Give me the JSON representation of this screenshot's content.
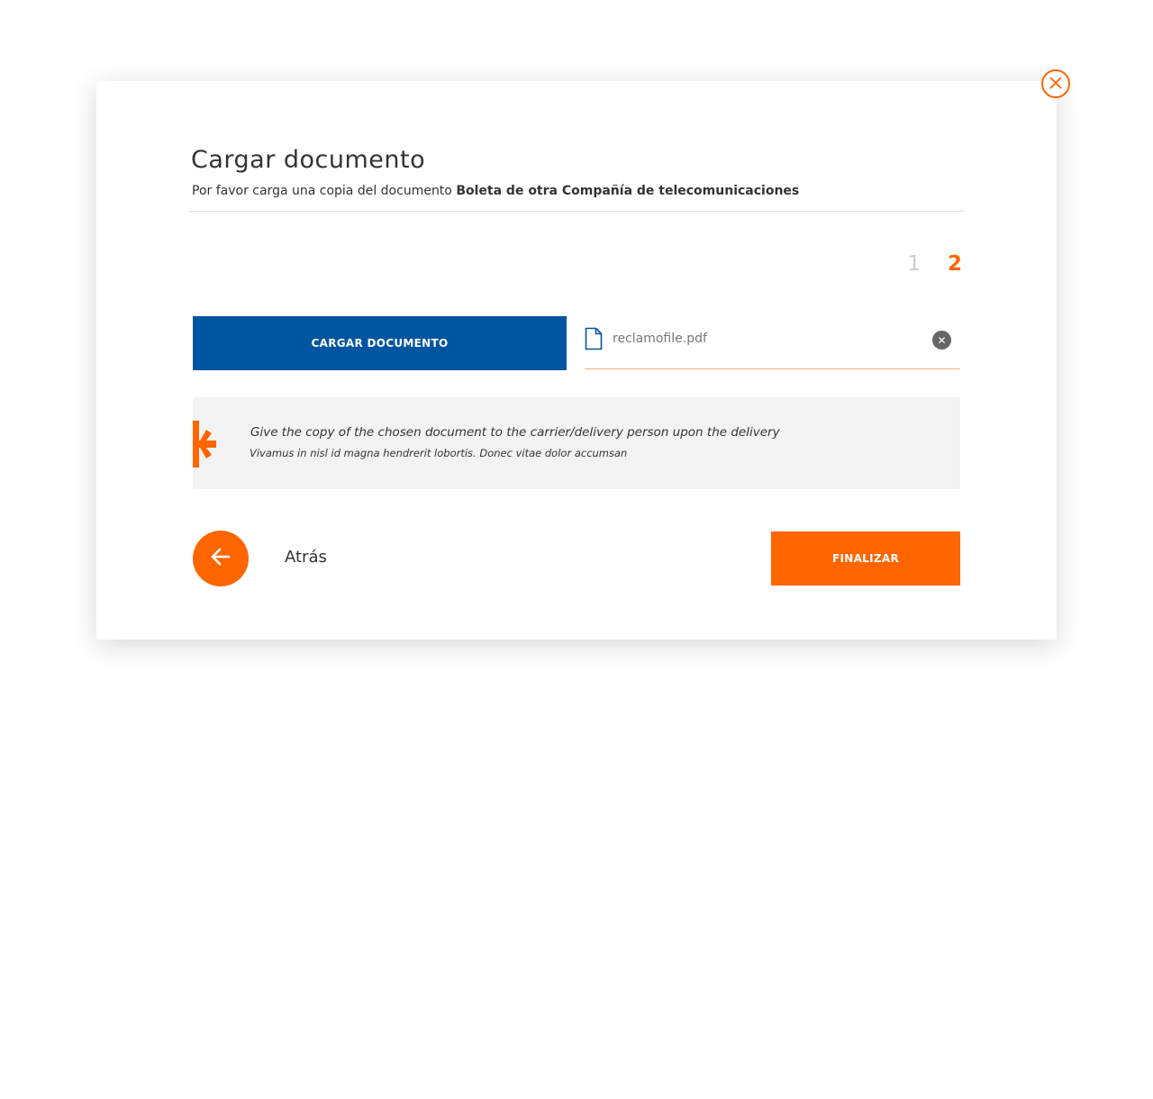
{
  "modal": {
    "title": "Cargar documento",
    "subtitle_prefix": "Por favor carga una copia del documento ",
    "subtitle_document": "Boleta de otra Compañía de telecomunicaciones",
    "close_icon": "close-icon"
  },
  "steps": [
    {
      "label": "1",
      "active": false
    },
    {
      "label": "2",
      "active": true
    }
  ],
  "upload": {
    "button_label": "CARGAR DOCUMENTO",
    "file_name": "reclamofile.pdf",
    "file_icon": "document-icon",
    "clear_icon": "clear-icon"
  },
  "info": {
    "title": "Give the copy of the chosen document to the carrier/delivery person upon the delivery",
    "text": "Vivamus in nisl id magna hendrerit lobortis. Donec vitae dolor accumsan",
    "icon": "asterisk-mark-icon"
  },
  "actions": {
    "back_label": "Atrás",
    "back_icon": "arrow-left-icon",
    "finish_label": "FINALIZAR"
  },
  "colors": {
    "accent": "#ff6600",
    "primary_blue": "#0055a0",
    "info_background": "#f3f3f3"
  }
}
